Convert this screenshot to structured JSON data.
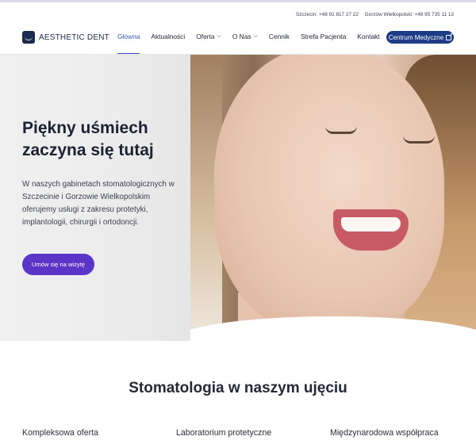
{
  "topbar": {
    "szczecin": "Szczecin: +48 91 817 27 22",
    "gorzow": "Gorzów Wielkopolski: +48 95 735 11 13"
  },
  "logo": {
    "text": "AESTHETIC DENT"
  },
  "nav": {
    "items": [
      {
        "label": "Główna",
        "active": true
      },
      {
        "label": "Aktualności"
      },
      {
        "label": "Oferta",
        "dropdown": true
      },
      {
        "label": "O Nas",
        "dropdown": true
      },
      {
        "label": "Cennik"
      },
      {
        "label": "Strefa Pacjenta"
      },
      {
        "label": "Kontakt"
      }
    ],
    "cta": "Centrum Medyczne"
  },
  "hero": {
    "title": "Piękny uśmiech zaczyna się tutaj",
    "text": "W naszych gabinetach stomatologicznych w Szczecinie i Gorzowie Wielkopolskim oferujemy usługi z zakresu protetyki, implantologii, chirurgii i ortodoncji.",
    "cta": "Umów się na wizytę"
  },
  "section": {
    "title": "Stomatologia w naszym ujęciu",
    "features": [
      "Kompleksowa oferta",
      "Laboratorium protetyczne",
      "Międzynarodowa współpraca"
    ]
  },
  "colors": {
    "brand": "#1d2b4f",
    "accent": "#3a55b8",
    "cta": "#5a35c7"
  }
}
